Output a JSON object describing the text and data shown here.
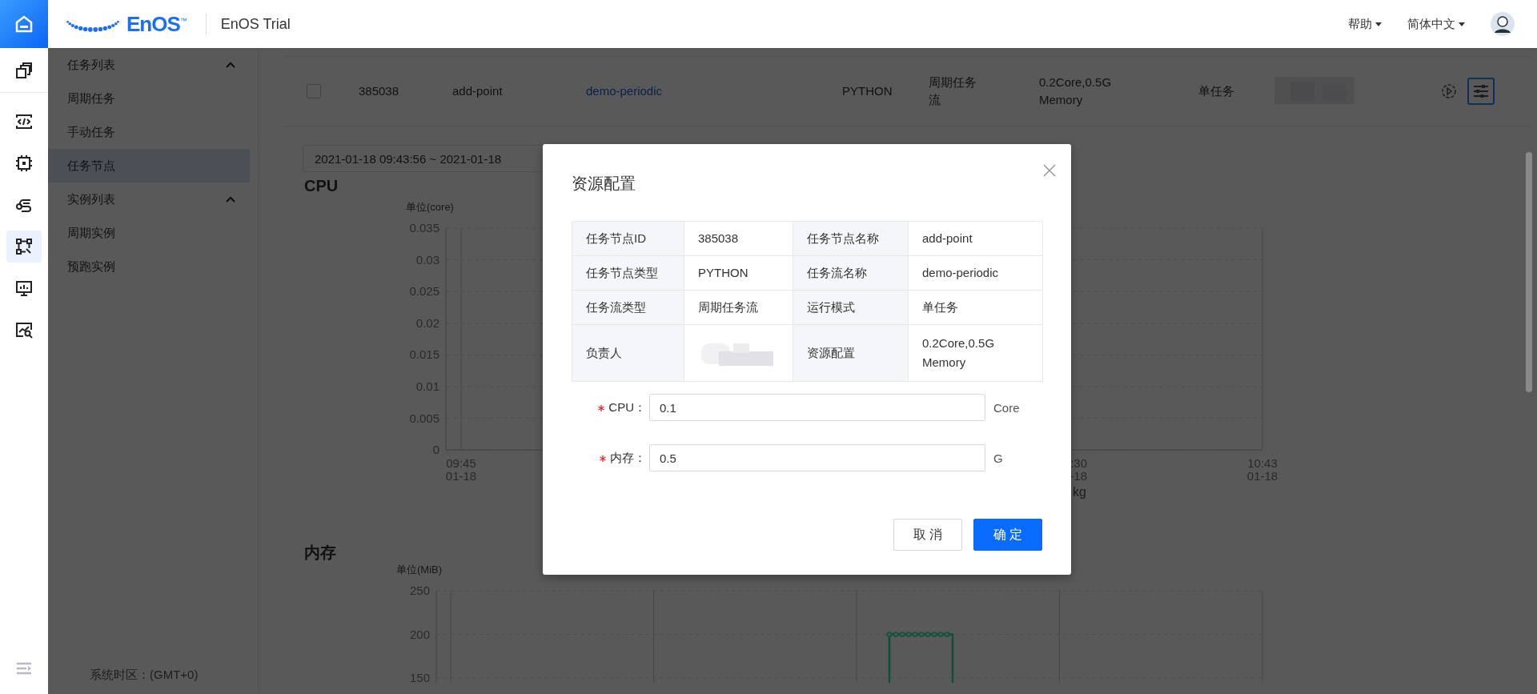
{
  "top_bar": {
    "logo": "EnOS$^{™}$",
    "product": "EnOS Trial",
    "menus": [
      {
        "label": "帮助"
      },
      {
        "label": "简体中文"
      }
    ]
  },
  "icon_rail": {
    "items": [
      {
        "selected": false
      },
      {
        "selected": false
      },
      {
        "selected": false
      },
      {
        "selected": false
      },
      {
        "selected": true
      },
      {
        "selected": false
      },
      {
        "selected": false
      }
    ]
  },
  "sidebar": {
    "groups": [
      {
        "label": "任务列表",
        "expanded": true,
        "items": [
          {
            "label": "周期任务",
            "selected": false
          },
          {
            "label": "手动任务",
            "selected": false
          },
          {
            "label": "任务节点",
            "selected": true
          }
        ]
      },
      {
        "label": "实例列表",
        "expanded": true,
        "items": [
          {
            "label": "周期实例",
            "selected": false
          },
          {
            "label": "预跑实例",
            "selected": false
          }
        ]
      }
    ],
    "footer": "系统时区：(GMT+0)"
  },
  "task_row": {
    "checked": false,
    "cells": [
      {
        "kind": "text",
        "text": "385038"
      },
      {
        "kind": "text",
        "text": "add-point"
      },
      {
        "kind": "link",
        "text": "demo-periodic"
      },
      {
        "kind": "text",
        "text": "PYTHON"
      },
      {
        "kind": "text",
        "text": "周期任务流"
      },
      {
        "kind": "text",
        "text": "0.2Core,0.5G Memory"
      },
      {
        "kind": "text",
        "text": "单任务"
      },
      {
        "kind": "redacted"
      }
    ],
    "actions": [
      {
        "focused": false
      },
      {
        "focused": true
      }
    ]
  },
  "date_range": {
    "value": "2021-01-18 09:43:56 ~ 2021-01-18"
  },
  "charts": [
    {
      "title": "CPU",
      "unit": "单位(core)",
      "yticks": [
        "0.035",
        "0.03",
        "0.025",
        "0.02",
        "0.015",
        "0.01",
        "0.005",
        "0"
      ],
      "xlabels": [
        {
          "time": "09:45",
          "date": "01-18"
        },
        {
          "time": ":30",
          "date": "-18"
        },
        {
          "time": "10:43",
          "date": "01-18"
        }
      ],
      "note": "kg"
    },
    {
      "title": "内存",
      "unit": "单位(MiB)",
      "yticks": [
        "250",
        "200",
        "150"
      ]
    }
  ],
  "dialog": {
    "title": "资源配置",
    "info": [
      [
        {
          "label": "任务节点ID",
          "value": "385038"
        },
        {
          "label": "任务节点名称",
          "value": "add-point"
        }
      ],
      [
        {
          "label": "任务节点类型",
          "value": "PYTHON"
        },
        {
          "label": "任务流名称",
          "value": "demo-periodic"
        }
      ],
      [
        {
          "label": "任务流类型",
          "value": "周期任务流"
        },
        {
          "label": "运行模式",
          "value": "单任务"
        }
      ],
      [
        {
          "label": "负责人",
          "redacted": true
        },
        {
          "label": "资源配置",
          "value": "0.2Core,0.5G Memory"
        }
      ]
    ],
    "fields": [
      {
        "label": "CPU：",
        "required": true,
        "value": "0.1",
        "unit": "Core"
      },
      {
        "label": "内存：",
        "required": true,
        "value": "0.5",
        "unit": "G"
      }
    ],
    "buttons": [
      {
        "label": "取 消",
        "primary": false
      },
      {
        "label": "确 定",
        "primary": true
      }
    ]
  }
}
